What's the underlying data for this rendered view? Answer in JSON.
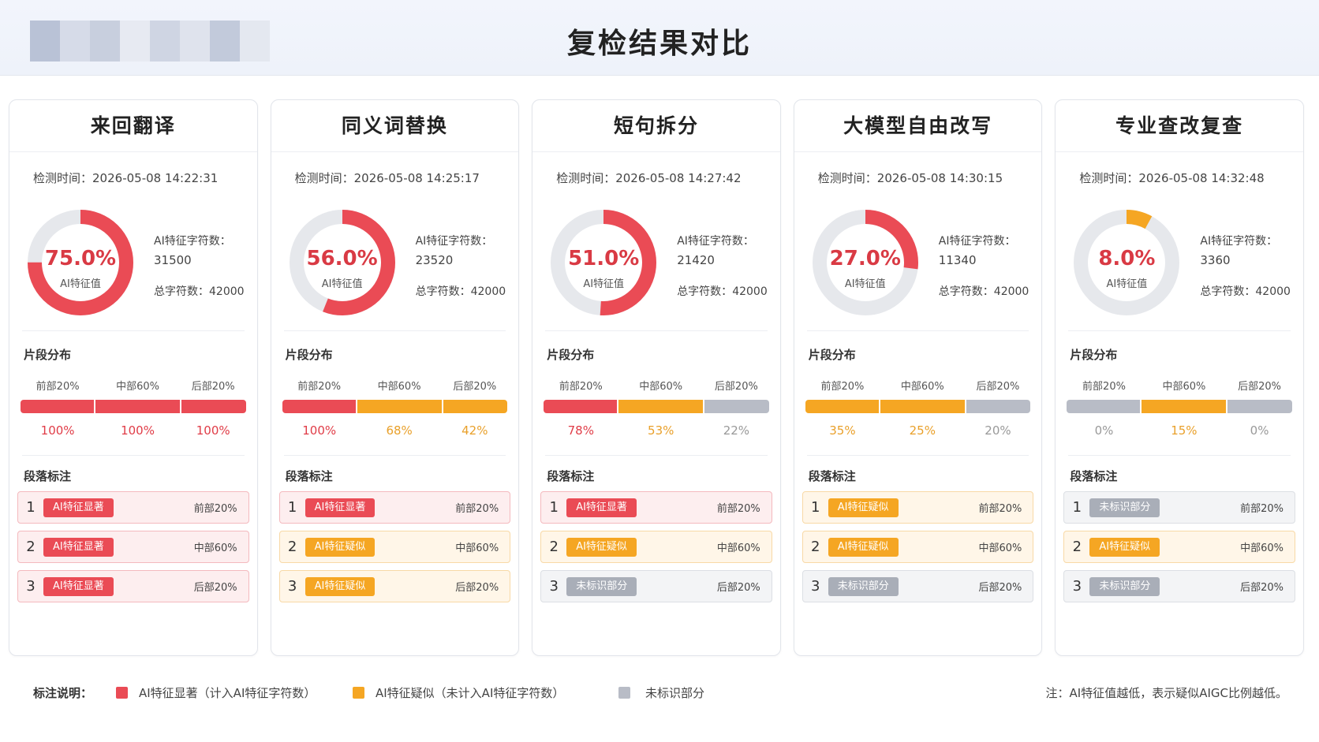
{
  "page": {
    "title": "复检结果对比"
  },
  "colors": {
    "red": "#ea4b55",
    "orange": "#f5a623",
    "gray": "#b8bcc6",
    "track": "#e6e8ec"
  },
  "labels": {
    "time_prefix": "检测时间：",
    "ai_chars_label": "AI特征字符数：",
    "total_prefix": "总字符数：",
    "ai_value_label": "AI特征值",
    "segment_title": "片段分布",
    "paragraph_title": "段落标注",
    "segment_names": [
      "前部20%",
      "中部60%",
      "后部20%"
    ]
  },
  "cards": [
    {
      "title": "来回翻译",
      "time": "2026-05-08 14:22:31",
      "pct": 75.0,
      "pct_text": "75.0%",
      "ai_chars": "31500",
      "total": "42000",
      "segments": [
        {
          "value": "100%",
          "level": "red"
        },
        {
          "value": "100%",
          "level": "red"
        },
        {
          "value": "100%",
          "level": "red"
        }
      ],
      "paragraphs": [
        {
          "num": "1",
          "label": "AI特征显著",
          "level": "red",
          "pos": "前部20%"
        },
        {
          "num": "2",
          "label": "AI特征显著",
          "level": "red",
          "pos": "中部60%"
        },
        {
          "num": "3",
          "label": "AI特征显著",
          "level": "red",
          "pos": "后部20%"
        }
      ]
    },
    {
      "title": "同义词替换",
      "time": "2026-05-08 14:25:17",
      "pct": 56.0,
      "pct_text": "56.0%",
      "ai_chars": "23520",
      "total": "42000",
      "segments": [
        {
          "value": "100%",
          "level": "red"
        },
        {
          "value": "68%",
          "level": "orange"
        },
        {
          "value": "42%",
          "level": "orange"
        }
      ],
      "paragraphs": [
        {
          "num": "1",
          "label": "AI特征显著",
          "level": "red",
          "pos": "前部20%"
        },
        {
          "num": "2",
          "label": "AI特征疑似",
          "level": "orange",
          "pos": "中部60%"
        },
        {
          "num": "3",
          "label": "AI特征疑似",
          "level": "orange",
          "pos": "后部20%"
        }
      ]
    },
    {
      "title": "短句拆分",
      "time": "2026-05-08 14:27:42",
      "pct": 51.0,
      "pct_text": "51.0%",
      "ai_chars": "21420",
      "total": "42000",
      "segments": [
        {
          "value": "78%",
          "level": "red"
        },
        {
          "value": "53%",
          "level": "orange"
        },
        {
          "value": "22%",
          "level": "gray"
        }
      ],
      "paragraphs": [
        {
          "num": "1",
          "label": "AI特征显著",
          "level": "red",
          "pos": "前部20%"
        },
        {
          "num": "2",
          "label": "AI特征疑似",
          "level": "orange",
          "pos": "中部60%"
        },
        {
          "num": "3",
          "label": "未标识部分",
          "level": "gray",
          "pos": "后部20%"
        }
      ]
    },
    {
      "title": "大模型自由改写",
      "time": "2026-05-08 14:30:15",
      "pct": 27.0,
      "pct_text": "27.0%",
      "ai_chars": "11340",
      "total": "42000",
      "segments": [
        {
          "value": "35%",
          "level": "orange"
        },
        {
          "value": "25%",
          "level": "orange"
        },
        {
          "value": "20%",
          "level": "gray"
        }
      ],
      "paragraphs": [
        {
          "num": "1",
          "label": "AI特征疑似",
          "level": "orange",
          "pos": "前部20%"
        },
        {
          "num": "2",
          "label": "AI特征疑似",
          "level": "orange",
          "pos": "中部60%"
        },
        {
          "num": "3",
          "label": "未标识部分",
          "level": "gray",
          "pos": "后部20%"
        }
      ]
    },
    {
      "title": "专业查改复查",
      "time": "2026-05-08 14:32:48",
      "pct": 8.0,
      "pct_text": "8.0%",
      "ai_chars": "3360",
      "total": "42000",
      "segments": [
        {
          "value": "0%",
          "level": "gray"
        },
        {
          "value": "15%",
          "level": "orange"
        },
        {
          "value": "0%",
          "level": "gray"
        }
      ],
      "paragraphs": [
        {
          "num": "1",
          "label": "未标识部分",
          "level": "gray",
          "pos": "前部20%"
        },
        {
          "num": "2",
          "label": "AI特征疑似",
          "level": "orange",
          "pos": "中部60%"
        },
        {
          "num": "3",
          "label": "未标识部分",
          "level": "gray",
          "pos": "后部20%"
        }
      ]
    }
  ],
  "legend": {
    "title": "标注说明：",
    "items": [
      {
        "label": "AI特征显著（计入AI特征字符数）",
        "level": "red"
      },
      {
        "label": "AI特征疑似（未计入AI特征字符数）",
        "level": "orange"
      },
      {
        "label": "未标识部分",
        "level": "gray"
      }
    ],
    "note": "注：AI特征值越低，表示疑似AIGC比例越低。"
  }
}
